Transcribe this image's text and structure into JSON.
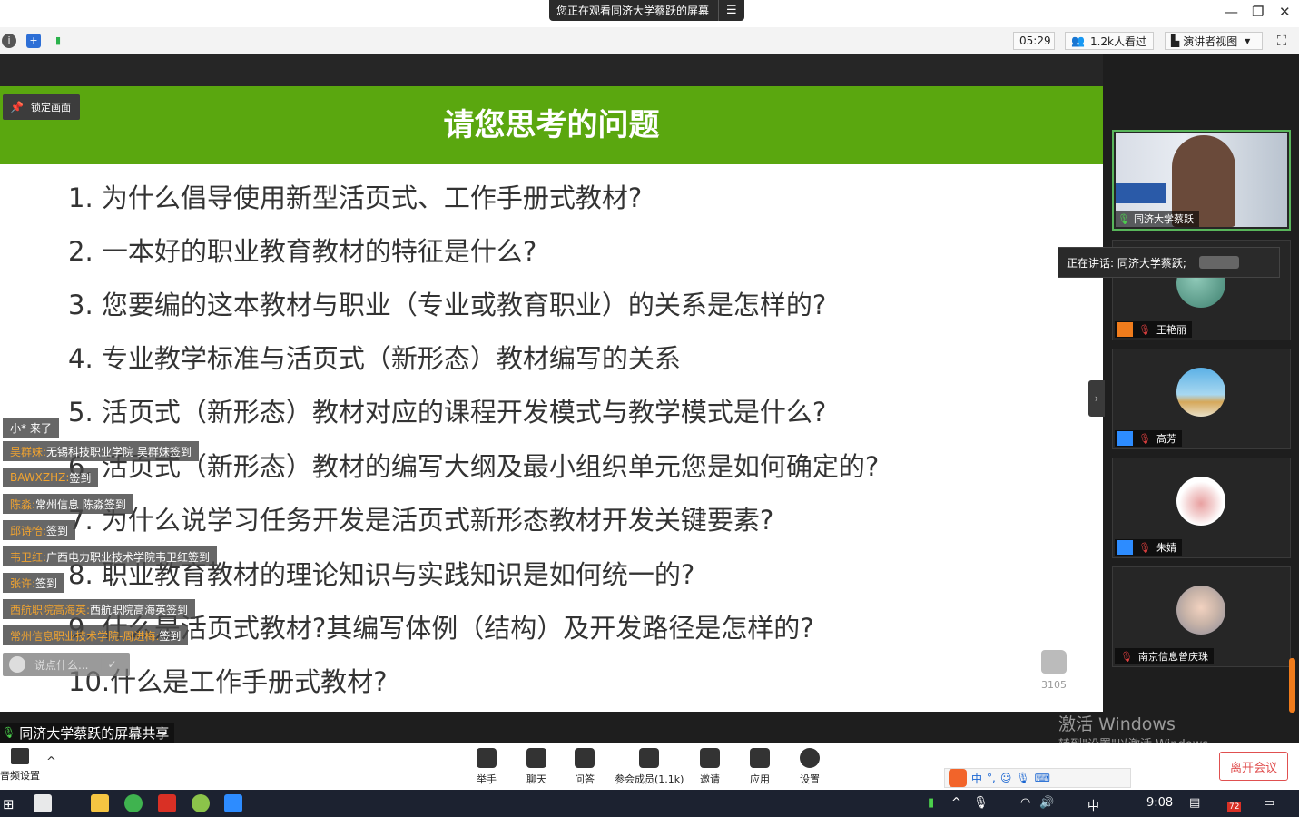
{
  "window": {
    "share_banner": "您正在观看同济大学蔡跃的屏幕",
    "menu_glyph": "☰",
    "minimize": "—",
    "restore": "❐",
    "close": "✕"
  },
  "toolbar": {
    "timer": "05:29",
    "viewers": "1.2k人看过",
    "view_mode": "演讲者视图",
    "view_mode_arrow": "▾",
    "fullscreen": "⛶"
  },
  "slide": {
    "lock_label": "锁定画面",
    "title": "请您思考的问题",
    "questions": [
      "1.  为什么倡导使用新型活页式、工作手册式教材?",
      "2.  一本好的职业教育教材的特征是什么?",
      "3.  您要编的这本教材与职业（专业或教育职业）的关系是怎样的?",
      "4.  专业教学标准与活页式（新形态）教材编写的关系",
      "5.  活页式（新形态）教材对应的课程开发模式与教学模式是什么?",
      "6.  活页式（新形态）教材的编写大纲及最小组织单元您是如何确定的?",
      "7.  为什么说学习任务开发是活页式新形态教材开发关键要素?",
      "8.  职业教育教材的理论知识与实践知识是如何统一的?",
      "9.  什么是活页式教材?其编写体例（结构）及开发路径是怎样的?",
      "10.什么是工作手册式教材?"
    ]
  },
  "chat": {
    "messages": [
      {
        "name": "",
        "text": "小* 来了"
      },
      {
        "name": "吴群妹:",
        "text": " 无锡科技职业学院 吴群妹签到"
      },
      {
        "name": "BAWXZHZ:",
        "text": " 签到"
      },
      {
        "name": "陈淼:",
        "text": " 常州信息 陈淼签到"
      },
      {
        "name": "邱诗怡:",
        "text": " 签到"
      },
      {
        "name": "韦卫红:",
        "text": " 广西电力职业技术学院韦卫红签到"
      },
      {
        "name": "张许:",
        "text": " 签到"
      },
      {
        "name": "西航职院高海英:",
        "text": " 西航职院高海英签到"
      },
      {
        "name": "常州信息职业技术学院-周进梅:",
        "text": " 签到"
      }
    ],
    "input_placeholder": "说点什么...",
    "send_glyph": "✓"
  },
  "likes": {
    "count": "3105"
  },
  "participants": {
    "speaking_label": "正在讲话: 同济大学蔡跃;",
    "tiles": [
      {
        "name": "同济大学蔡跃"
      },
      {
        "name": "王艳丽"
      },
      {
        "name": "高芳"
      },
      {
        "name": "朱婧"
      },
      {
        "name": "南京信息曾庆珠"
      }
    ],
    "collapse_glyph": "›"
  },
  "share_label": "同济大学蔡跃的屏幕共享",
  "watermark": {
    "line1": "激活 Windows",
    "line2": "转到\"设置\"以激活 Windows。"
  },
  "controls": {
    "audio": "音频设置",
    "audio_caret": "^",
    "raise_hand": "举手",
    "chat": "聊天",
    "qa": "问答",
    "members": "参会成员(1.1k)",
    "invite": "邀请",
    "apps": "应用",
    "settings": "设置",
    "leave": "离开会议"
  },
  "ime": {
    "mode": "中",
    "punct": "°,"
  },
  "taskbar": {
    "clock": "9:08",
    "ime_lang": "中",
    "badge": "72"
  },
  "colors": {
    "slide_header": "#5aa70f",
    "chat_name": "#f0a330",
    "leave": "#e05050",
    "active_border": "#58b55a"
  }
}
